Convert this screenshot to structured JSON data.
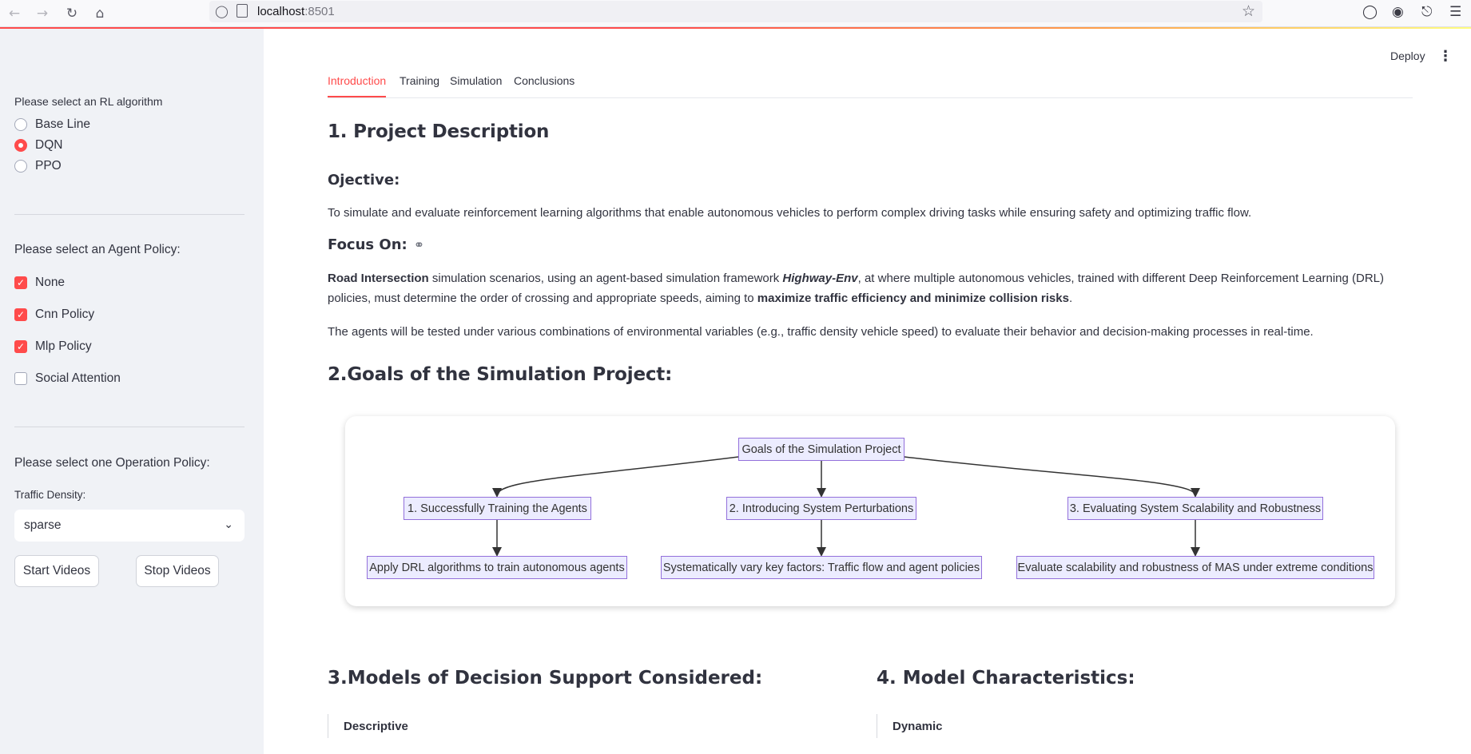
{
  "browser": {
    "url_host": "localhost",
    "url_port": ":8501"
  },
  "sidebar": {
    "rl_label": "Please select an RL algorithm",
    "rl_options": [
      {
        "label": "Base Line",
        "selected": false
      },
      {
        "label": "DQN",
        "selected": true
      },
      {
        "label": "PPO",
        "selected": false
      }
    ],
    "policy_label": "Please select an Agent Policy:",
    "policies": [
      {
        "label": "None",
        "checked": true
      },
      {
        "label": "Cnn Policy",
        "checked": true
      },
      {
        "label": "Mlp Policy",
        "checked": true
      },
      {
        "label": "Social Attention",
        "checked": false
      }
    ],
    "operation_label": "Please select one Operation Policy:",
    "density_label": "Traffic Density:",
    "density_value": "sparse",
    "start_label": "Start Videos",
    "stop_label": "Stop Videos"
  },
  "header": {
    "deploy_label": "Deploy"
  },
  "tabs": [
    {
      "label": "Introduction",
      "active": true
    },
    {
      "label": "Training",
      "active": false
    },
    {
      "label": "Simulation",
      "active": false
    },
    {
      "label": "Conclusions",
      "active": false
    }
  ],
  "content": {
    "section1_title": "1. Project Description",
    "objective_title": "Ojective:",
    "objective_text": "To simulate and evaluate reinforcement learning algorithms that enable autonomous vehicles to perform complex driving tasks while ensuring safety and optimizing traffic flow.",
    "focus_title": "Focus On:",
    "focus_bold1": "Road Intersection",
    "focus_text1": " simulation scenarios, using an agent-based simulation framework ",
    "focus_italic": "Highway-Env",
    "focus_text2": ", at where multiple autonomous vehicles, trained with different Deep Reinforcement Learning (DRL) policies, must determine the order of crossing and appropriate speeds, aiming to ",
    "focus_bold2": "maximize traffic efficiency and minimize collision risks",
    "focus_text3": ".",
    "agents_text": "The agents will be tested under various combinations of environmental variables (e.g., traffic density vehicle speed) to evaluate their behavior and decision-making processes in real-time.",
    "section2_title": "2.Goals of the Simulation Project:",
    "section3_title": "3.Models of Decision Support Considered:",
    "section3_item": "Descriptive",
    "section4_title": "4. Model Characteristics:",
    "section4_item": "Dynamic"
  },
  "diagram": {
    "root": "Goals of the Simulation Project",
    "goals": [
      "1. Successfully Training the Agents",
      "2. Introducing System Perturbations",
      "3. Evaluating System Scalability and Robustness"
    ],
    "details": [
      "Apply DRL algorithms to train autonomous agents",
      "Systematically vary key factors: Traffic flow and agent policies",
      "Evaluate scalability and robustness of MAS under extreme conditions"
    ]
  }
}
